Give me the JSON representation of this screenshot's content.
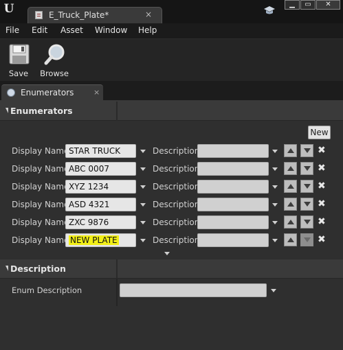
{
  "window": {
    "document_tab": "E_Truck_Plate*",
    "tab_close": "×"
  },
  "menu": [
    "File",
    "Edit",
    "Asset",
    "Window",
    "Help"
  ],
  "toolbar": {
    "save_label": "Save",
    "browse_label": "Browse"
  },
  "panel_tab": {
    "label": "Enumerators",
    "close": "×"
  },
  "enumerators_section": {
    "title": "Enumerators",
    "new_button": "New",
    "display_name_label": "Display Name",
    "description_label": "Description",
    "rows": [
      {
        "name": "STAR TRUCK",
        "description": "",
        "highlighted": false,
        "down_enabled": true
      },
      {
        "name": "ABC 0007",
        "description": "",
        "highlighted": false,
        "down_enabled": true
      },
      {
        "name": "XYZ 1234",
        "description": "",
        "highlighted": false,
        "down_enabled": true
      },
      {
        "name": "ASD 4321",
        "description": "",
        "highlighted": false,
        "down_enabled": true
      },
      {
        "name": "ZXC 9876",
        "description": "",
        "highlighted": false,
        "down_enabled": true
      },
      {
        "name": "NEW PLATE",
        "description": "",
        "highlighted": true,
        "down_enabled": false
      }
    ]
  },
  "description_section": {
    "title": "Description",
    "enum_description_label": "Enum Description",
    "enum_description_value": ""
  },
  "icons": {
    "logo": "unreal-logo-icon",
    "save": "floppy-disk-icon",
    "browse": "magnifier-icon",
    "delete": "close-x-icon"
  },
  "colors": {
    "highlight": "#f2ef16",
    "panel_bg": "#2f2f2f",
    "header_bg": "#3a3a3a"
  }
}
